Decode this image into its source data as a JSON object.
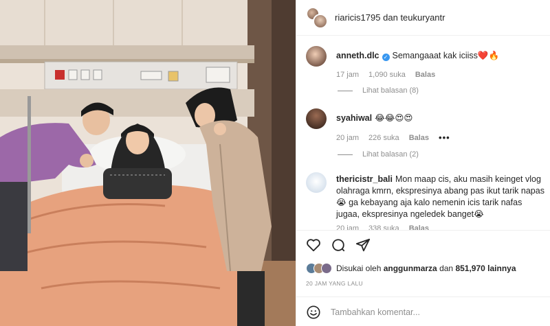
{
  "post": {
    "photo_alt_icon": "photo",
    "header": {
      "user1": "riaricis1795",
      "and": "dan",
      "user2": "teukuryantr"
    },
    "comments": [
      {
        "username": "anneth.dlc",
        "verified": true,
        "text": "Semangaaat kak iciiss❤️🔥",
        "time": "17 jam",
        "likes": "1,090 suka",
        "reply": "Balas",
        "view_replies": "Lihat balasan (8)"
      },
      {
        "username": "syahiwal",
        "verified": false,
        "text": "😂😂😍😍",
        "time": "20 jam",
        "likes": "226 suka",
        "reply": "Balas",
        "more": "•••",
        "view_replies": "Lihat balasan (2)"
      },
      {
        "username": "thericistr_bali",
        "verified": false,
        "text": "Mon maap cis, aku masih keinget vlog olahraga kmrn, ekspresinya abang pas ikut tarik napas 😭 ga kebayang aja kalo nemenin icis tarik nafas jugaa, ekspresinya ngeledek banget😭",
        "time": "20 jam",
        "likes": "338 suka",
        "reply": "Balas"
      }
    ],
    "liked_by": {
      "prefix": "Disukai oleh",
      "user": "anggunmarza",
      "connector": "dan",
      "others": "851,970 lainnya"
    },
    "time_ago": "20 JAM YANG LALU",
    "add_comment_placeholder": "Tambahkan komentar...",
    "icons": [
      "heart-icon",
      "comment-icon",
      "share-icon",
      "smile-icon"
    ],
    "colors": {
      "verified": "#3897f0",
      "muted": "#8e8e8e",
      "text": "#262626"
    }
  }
}
